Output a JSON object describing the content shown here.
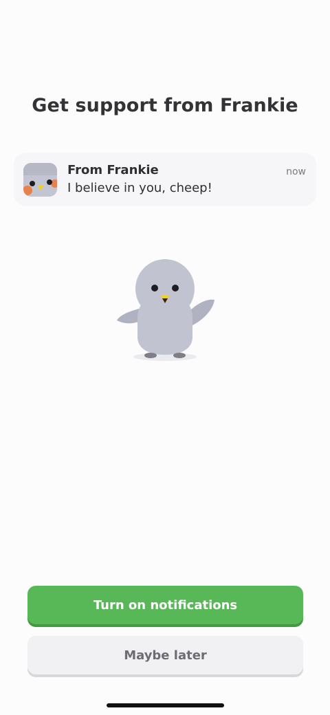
{
  "page": {
    "title": "Get support from Frankie"
  },
  "notification": {
    "icon": "frankie-avatar-icon",
    "sender": "From Frankie",
    "message": "I believe in you, cheep!",
    "time": "now"
  },
  "mascot": {
    "icon": "frankie-bird-illustration"
  },
  "actions": {
    "primary_label": "Turn on notifications",
    "secondary_label": "Maybe later"
  },
  "colors": {
    "primary_button": "#58b757",
    "secondary_button": "#f1f0f2",
    "mascot_body": "#c2c3d0",
    "beak": "#f2d21b",
    "cheek": "#e8824c"
  }
}
